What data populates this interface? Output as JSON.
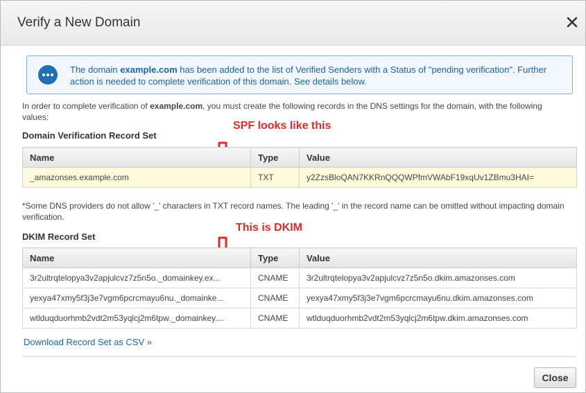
{
  "dialog": {
    "title": "Verify a New Domain",
    "close_icon": "close-icon"
  },
  "info": {
    "icon": "chat-bubble-icon",
    "text_pre": "The domain ",
    "domain": "example.com",
    "text_post": " has been added to the list of Verified Senders with a Status of \"pending verification\". Further action is needed to complete verification of this domain. See details below."
  },
  "intro": {
    "pre": "In order to complete verification of ",
    "domain": "example.com",
    "post": ", you must create the following records in the DNS settings for the domain, with the following values:"
  },
  "verification": {
    "title": "Domain Verification Record Set",
    "headers": {
      "name": "Name",
      "type": "Type",
      "value": "Value"
    },
    "rows": [
      {
        "name": "_amazonses.example.com",
        "type": "TXT",
        "value": "y2ZzsBloQAN7KKRnQQQWPfmVWAbF19xqUv1ZBmu3HAI="
      }
    ]
  },
  "note": "*Some DNS providers do not allow '_' characters in TXT record names. The leading '_' in the record name can be omitted without impacting domain verification.",
  "dkim": {
    "title": "DKIM Record Set",
    "headers": {
      "name": "Name",
      "type": "Type",
      "value": "Value"
    },
    "rows": [
      {
        "name": "3r2ultrqtelopya3v2apjulcvz7z5n5o._domainkey.ex...",
        "type": "CNAME",
        "value": "3r2ultrqtelopya3v2apjulcvz7z5n5o.dkim.amazonses.com"
      },
      {
        "name": "yexya47xmy5f3j3e7vgm6pcrcmayu6nu._domainke...",
        "type": "CNAME",
        "value": "yexya47xmy5f3j3e7vgm6pcrcmayu6nu.dkim.amazonses.com"
      },
      {
        "name": "wtlduqduorhmb2vdt2m53yqlcj2m6tpw._domainkey....",
        "type": "CNAME",
        "value": "wtlduqduorhmb2vdt2m53yqlcj2m6tpw.dkim.amazonses.com"
      }
    ]
  },
  "annotations": {
    "spf": "SPF looks like this",
    "dkim": "This is DKIM",
    "arrow_icon": "red-down-arrow-icon",
    "color": "#e02a2a"
  },
  "download_link": "Download Record Set as CSV »",
  "close_button": "Close"
}
